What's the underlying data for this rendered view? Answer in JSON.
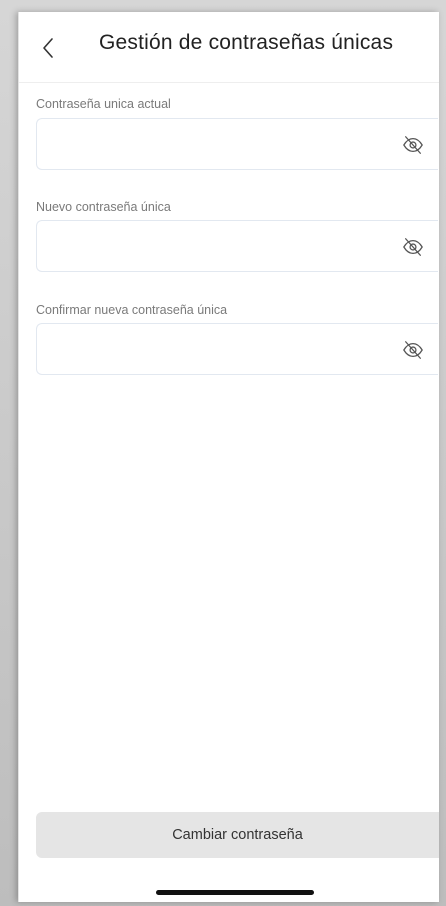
{
  "header": {
    "title": "Gestión de contraseñas únicas"
  },
  "form": {
    "fields": [
      {
        "label": "Contraseña unica actual",
        "value": ""
      },
      {
        "label": "Nuevo contraseña única",
        "value": ""
      },
      {
        "label": "Confirmar nueva contraseña única",
        "value": ""
      }
    ]
  },
  "actions": {
    "submit_label": "Cambiar contraseña"
  },
  "icons": {
    "back": "chevron-left-icon",
    "visibility": "eye-off-icon"
  },
  "colors": {
    "field_border": "#e2e8f0",
    "button_bg": "#e5e5e5",
    "title_text": "#222222",
    "label_text": "#7a7a7a"
  }
}
